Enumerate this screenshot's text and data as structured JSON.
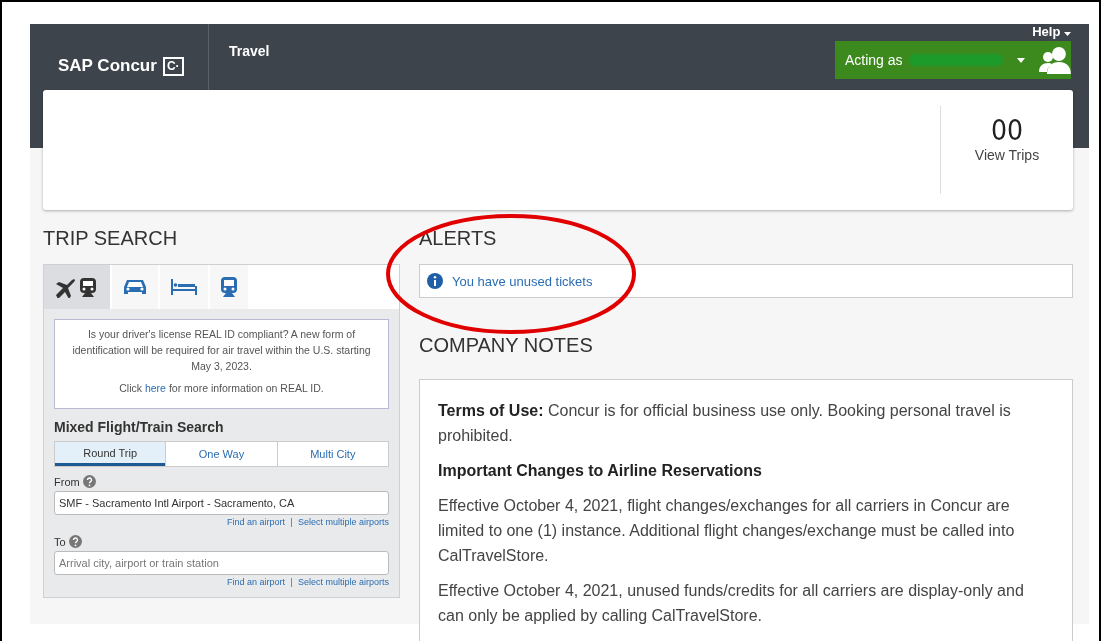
{
  "header": {
    "brand": "SAP Concur",
    "brand_mark": "C·",
    "nav": [
      "Travel"
    ],
    "help": "Help",
    "acting_as": "Acting as"
  },
  "summary": {
    "trip_count": "00",
    "view_trips": "View Trips"
  },
  "trip_search": {
    "title": "TRIP SEARCH",
    "tabs": [
      {
        "kind": "flight_train",
        "selected": true
      },
      {
        "kind": "car",
        "selected": false
      },
      {
        "kind": "hotel",
        "selected": false
      },
      {
        "kind": "train",
        "selected": false
      }
    ],
    "notice": {
      "text": "Is your driver's license REAL ID compliant? A new form of identification will be required for air travel within the U.S. starting May 3, 2023.",
      "click_before": "Click",
      "link": "here",
      "click_after": "for more information on REAL ID."
    },
    "form_title": "Mixed Flight/Train Search",
    "trip_types": [
      {
        "label": "Round Trip",
        "selected": true
      },
      {
        "label": "One Way",
        "selected": false
      },
      {
        "label": "Multi City",
        "selected": false
      }
    ],
    "fields": [
      {
        "label": "From",
        "value": "SMF - Sacramento Intl Airport - Sacramento, CA",
        "links": [
          "Find an airport",
          "Select multiple airports"
        ]
      },
      {
        "label": "To",
        "placeholder": "Arrival city, airport or train station",
        "links": [
          "Find an airport",
          "Select multiple airports"
        ]
      }
    ]
  },
  "alerts": {
    "title": "ALERTS",
    "items": [
      "You have unused tickets"
    ]
  },
  "company_notes": {
    "title": "COMPANY NOTES",
    "blocks": [
      {
        "kind": "paragraph",
        "text": "**Terms of Use:** Concur is for official business use only. Booking personal travel is prohibited."
      },
      {
        "kind": "heading",
        "text": "Important Changes to Airline Reservations"
      },
      {
        "kind": "paragraph",
        "text": "Effective October 4, 2021, flight changes/exchanges for all carriers in Concur are limited to one (1) instance. Additional flight changes/exchange must be called into CalTravelStore."
      },
      {
        "kind": "paragraph",
        "text": "Effective October 4, 2021, unused funds/credits for all carriers are display-only and can only be applied by calling CalTravelStore."
      }
    ]
  }
}
